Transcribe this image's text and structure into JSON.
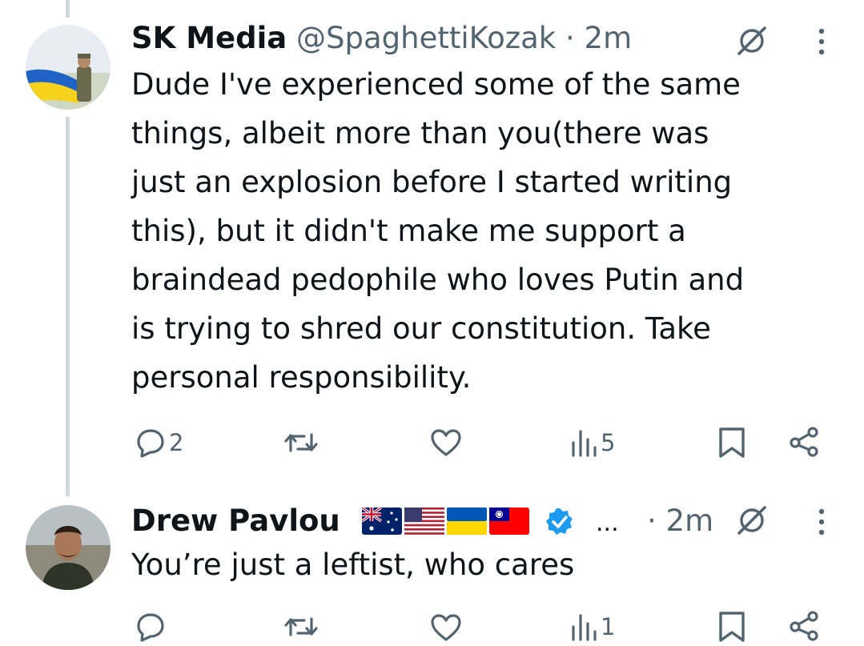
{
  "tweets": [
    {
      "display_name": "SK Media",
      "handle": "@SpaghettiKozak",
      "separator": "·",
      "time": "2m",
      "lines": [
        "Dude I've experienced some of the same",
        "things, albeit more than you(there was",
        "just an explosion before I started writing",
        "this), but it didn't make me support a",
        "braindead pedophile who loves Putin and",
        "is trying to shred our constitution. Take",
        "personal responsibility."
      ],
      "actions": {
        "replies": "2",
        "reposts": "",
        "likes": "",
        "views": "5"
      }
    },
    {
      "display_name": "Drew Pavlou",
      "truncation": "...",
      "separator": "·",
      "time": "2m",
      "lines": [
        "You’re just a leftist, who cares"
      ],
      "actions": {
        "replies": "",
        "reposts": "",
        "likes": "",
        "views": "1"
      }
    }
  ],
  "icons": {
    "reply": "speech-bubble-icon",
    "repost": "repost-arrows-icon",
    "like": "heart-icon",
    "views": "bar-chart-icon",
    "bookmark": "bookmark-icon",
    "share": "share-icon",
    "grok": "grok-slash-icon",
    "more": "vertical-dots-icon",
    "verified": "verified-badge-icon",
    "flags": [
      "australia-flag-icon",
      "usa-flag-icon",
      "ukraine-flag-icon",
      "taiwan-flag-icon"
    ]
  },
  "colors": {
    "text": "#0f1419",
    "secondary": "#536471",
    "thread_line": "#cfd9de",
    "verified": "#1d9bf0",
    "icon": "#536471"
  }
}
